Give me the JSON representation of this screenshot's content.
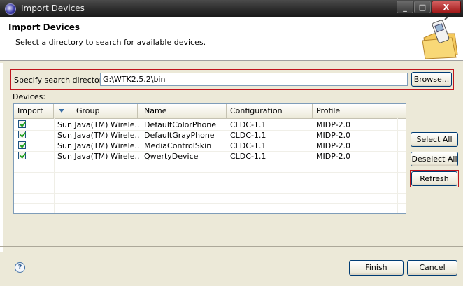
{
  "window": {
    "title": "Import Devices"
  },
  "titlebar_buttons": {
    "minimize": "_",
    "maximize": "□",
    "close": "X"
  },
  "header": {
    "title": "Import Devices",
    "description": "Select a directory to search for available devices."
  },
  "search": {
    "label": "Specify search directory:",
    "value": "G:\\WTK2.5.2\\bin",
    "browse_label": "Browse..."
  },
  "devices": {
    "label": "Devices:",
    "columns": [
      "Import",
      "Group",
      "Name",
      "Configuration",
      "Profile"
    ],
    "rows": [
      {
        "import": true,
        "group": "Sun Java(TM) Wirele...",
        "name": "DefaultColorPhone",
        "configuration": "CLDC-1.1",
        "profile": "MIDP-2.0"
      },
      {
        "import": true,
        "group": "Sun Java(TM) Wirele...",
        "name": "DefaultGrayPhone",
        "configuration": "CLDC-1.1",
        "profile": "MIDP-2.0"
      },
      {
        "import": true,
        "group": "Sun Java(TM) Wirele...",
        "name": "MediaControlSkin",
        "configuration": "CLDC-1.1",
        "profile": "MIDP-2.0"
      },
      {
        "import": true,
        "group": "Sun Java(TM) Wirele...",
        "name": "QwertyDevice",
        "configuration": "CLDC-1.1",
        "profile": "MIDP-2.0"
      }
    ]
  },
  "side_buttons": {
    "select_all": "Select All",
    "deselect_all": "Deselect All",
    "refresh": "Refresh"
  },
  "footer": {
    "help_icon": "?",
    "finish": "Finish",
    "cancel": "Cancel"
  },
  "colors": {
    "highlight_outline": "#c0161e",
    "titlebar": "#2a2a2a"
  }
}
